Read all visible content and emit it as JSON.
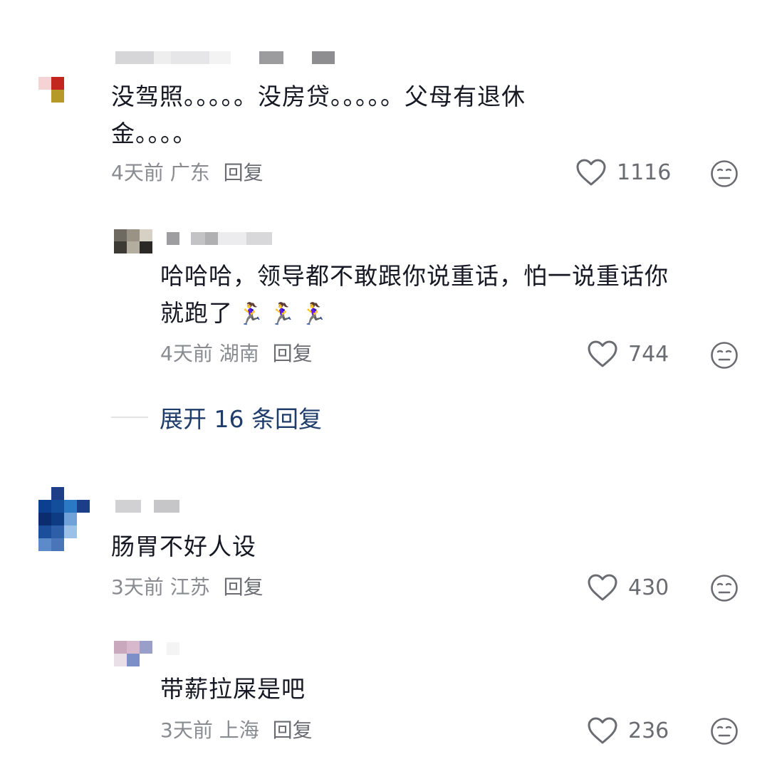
{
  "comments": [
    {
      "text_line1": "没驾照。。。。。没房贷。。。。。父母有退休",
      "text_line2": "金。。。。",
      "time": "4天前",
      "location": "广东",
      "reply_label": "回复",
      "likes": "1116",
      "replies": [
        {
          "text_line1": "哈哈哈，领导都不敢跟你说重话，怕一说重话你",
          "text_line2": "就跑了",
          "time": "4天前",
          "location": "湖南",
          "reply_label": "回复",
          "likes": "744"
        }
      ],
      "expand_label": "展开 16 条回复"
    },
    {
      "text_line1": "肠胃不好人设",
      "time": "3天前",
      "location": "江苏",
      "reply_label": "回复",
      "likes": "430",
      "replies": [
        {
          "text_line1": "带薪拉屎是吧",
          "time": "3天前",
          "location": "上海",
          "reply_label": "回复",
          "likes": "236"
        }
      ]
    }
  ],
  "icons": {
    "like": "heart-outline-icon",
    "emoji": "neutral-face-icon",
    "runner": "woman-running-emoji"
  },
  "colors": {
    "text": "#161823",
    "meta": "#8a8b91",
    "expand": "#1f3d6b"
  }
}
